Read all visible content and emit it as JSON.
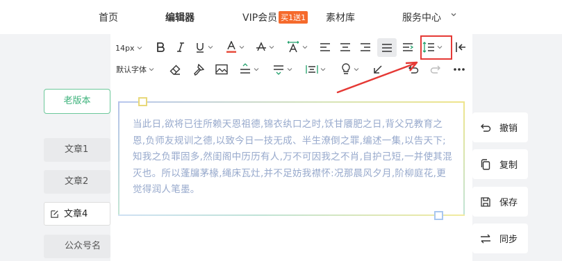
{
  "nav": {
    "home": "首页",
    "editor": "编辑器",
    "vip": "VIP会员",
    "vip_badge": "买1送1",
    "materials": "素材库",
    "service": "服务中心"
  },
  "sidebar_left": {
    "old_version": "老版本",
    "articles": [
      "文章1",
      "文章2",
      "文章4",
      "公众号名"
    ]
  },
  "toolbar": {
    "font_size": "14px",
    "font_family": "默认字体"
  },
  "content": {
    "text": "当此日,欲将已往所赖天恩祖德,锦衣纨口之时,饫甘餍肥之日,背父兄教育之恩,负师友规训之德,以致今日一技无成、半生潦倒之罪,编述一集,以告天下;知我之负罪固多,然闺阁中历历有人,万不可因我之不肖,自护己短,一并使其混灭也。所以蓬牖茅椽,绳床瓦灶,并不足妨我襟怀:况那晨风夕月,阶柳庭花,更觉得润人笔墨。"
  },
  "sidebar_right": {
    "undo": "撤销",
    "copy": "复制",
    "save": "保存",
    "sync": "同步"
  },
  "colors": {
    "accent_green": "#3bb27a",
    "vip_badge": "#f56a2c",
    "highlight_red": "#e53935",
    "body_text": "#97a9cc"
  }
}
